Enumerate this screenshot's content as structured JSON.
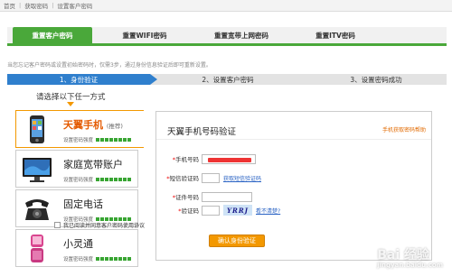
{
  "breadcrumb": {
    "home": "首页",
    "item1": "获取密码",
    "item2": "设置客户密码"
  },
  "tabs": [
    {
      "label": "重置客户密码"
    },
    {
      "label": "重置WIFI密码"
    },
    {
      "label": "重置宽带上网密码"
    },
    {
      "label": "重置ITV密码"
    }
  ],
  "notice": "当您忘记客户密码或设置初始密码时，仅需3步，通过身份信息验证后即可重新设置。",
  "steps": [
    {
      "label": "1、身份验证"
    },
    {
      "label": "2、设置客户密码"
    },
    {
      "label": "3、设置密码成功"
    }
  ],
  "choose_label": "请选择以下任一方式",
  "methods": [
    {
      "title": "天翼手机",
      "tag": "(推荐)",
      "strength_label": "设置密码强度",
      "active": true
    },
    {
      "title": "家庭宽带账户",
      "tag": "",
      "strength_label": "设置密码强度"
    },
    {
      "title": "固定电话",
      "tag": "",
      "strength_label": "设置密码强度"
    },
    {
      "title": "小灵通",
      "tag": "",
      "strength_label": "设置密码强度"
    }
  ],
  "panel": {
    "title": "天翼手机号码验证",
    "help": "手机获取密码帮助",
    "fields": {
      "phone_label": "手机号码",
      "sms_label": "短信验证码",
      "sms_link": "获取短信验证码",
      "cert_label": "证件号码",
      "verify_label": "验证码",
      "captcha_text": "YRRJ",
      "refresh_link": "看不清楚?"
    },
    "agree": "我已阅读并同意客户密码使用协议",
    "submit": "确认身份验证"
  },
  "watermark": {
    "main": "Bai 经验",
    "sub": "jingyan.baidu.com"
  }
}
